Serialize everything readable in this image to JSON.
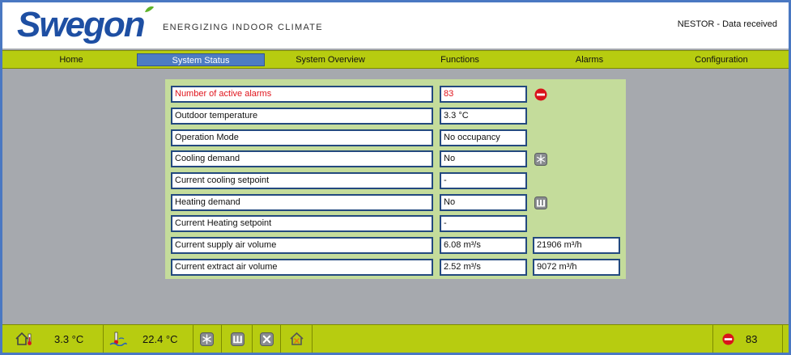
{
  "header": {
    "brand": "Swegon",
    "tagline": "ENERGIZING INDOOR CLIMATE",
    "status_message": "NESTOR - Data received"
  },
  "nav": {
    "items": [
      "Home",
      "System Status",
      "System Overview",
      "Functions",
      "Alarms",
      "Configuration"
    ],
    "active": "System Status"
  },
  "status_rows": [
    {
      "label": "Number of active alarms",
      "value": "83",
      "icon": "alarm-icon",
      "alert": true
    },
    {
      "label": "Outdoor temperature",
      "value": "3.3 °C"
    },
    {
      "label": "Operation Mode",
      "value": "No occupancy"
    },
    {
      "label": "Cooling demand",
      "value": "No",
      "icon": "snowflake-icon"
    },
    {
      "label": "Current cooling setpoint",
      "value": "-"
    },
    {
      "label": "Heating demand",
      "value": "No",
      "icon": "radiator-icon"
    },
    {
      "label": "Current Heating setpoint",
      "value": "-"
    },
    {
      "label": "Current supply air volume",
      "value": "6.08 m³/s",
      "value2": "21906 m³/h"
    },
    {
      "label": "Current extract air volume",
      "value": "2.52 m³/s",
      "value2": "9072 m³/h"
    }
  ],
  "footer": {
    "outdoor_temp": "3.3 °C",
    "supply_temp": "22.4 °C",
    "alarm_count": "83",
    "icons": [
      "house-thermometer-icon",
      "supply-temperature-icon",
      "snowflake-icon",
      "radiator-icon",
      "fan-stopped-icon",
      "house-alarm-icon",
      "alarm-icon"
    ]
  },
  "colors": {
    "accent_green": "#b7cc10",
    "panel_green": "#c4dc9b",
    "nav_active": "#4d7cc3",
    "border_blue": "#23497f",
    "alarm_red": "#e0141c",
    "brand_blue": "#1e4fa3"
  }
}
